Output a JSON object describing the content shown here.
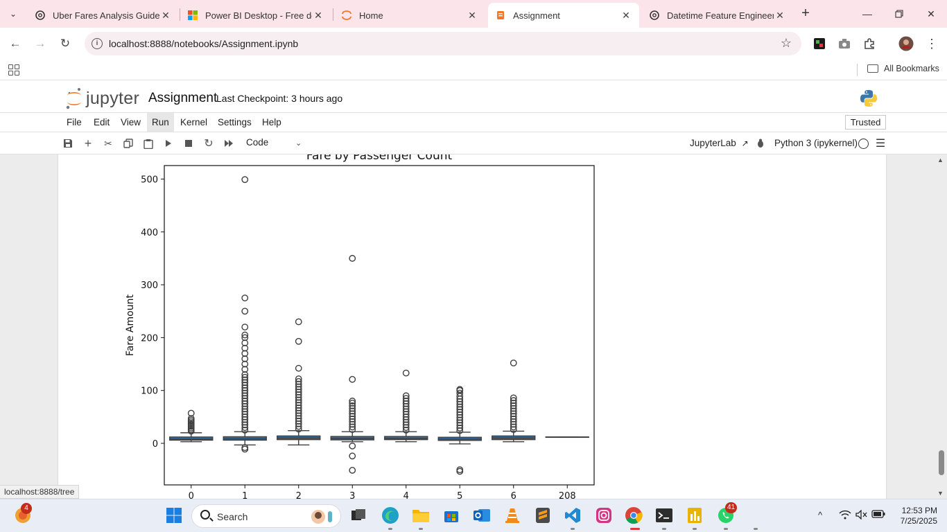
{
  "browser": {
    "tabs": [
      {
        "title": "Uber Fares Analysis Guide",
        "icon": "chatgpt-icon",
        "active": false
      },
      {
        "title": "Power BI Desktop - Free dow",
        "icon": "microsoft-icon",
        "active": false
      },
      {
        "title": "Home",
        "icon": "jupyter-icon",
        "active": false
      },
      {
        "title": "Assignment",
        "icon": "jupyter-notebook-icon",
        "active": true
      },
      {
        "title": "Datetime Feature Engineerin",
        "icon": "chatgpt-icon",
        "active": false
      }
    ],
    "url": "localhost:8888/notebooks/Assignment.ipynb",
    "bookmarks_label": "All Bookmarks",
    "status_url": "localhost:8888/tree"
  },
  "jupyter": {
    "logo_text": "jupyter",
    "notebook_title": "Assignment",
    "checkpoint": "Last Checkpoint: 3 hours ago",
    "menus": [
      "File",
      "Edit",
      "View",
      "Run",
      "Kernel",
      "Settings",
      "Help"
    ],
    "trusted": "Trusted",
    "cell_type": "Code",
    "jupyterlab_label": "JupyterLab",
    "kernel_name": "Python 3 (ipykernel)"
  },
  "chart_data": {
    "type": "box",
    "title": "Fare by Passenger Count",
    "ylabel": "Fare Amount",
    "xlabel": "",
    "ylim": [
      -60,
      520
    ],
    "yticks": [
      0,
      100,
      200,
      300,
      400,
      500
    ],
    "categories": [
      "0",
      "1",
      "2",
      "3",
      "4",
      "5",
      "6",
      "208"
    ],
    "box_color": "#3b6b96",
    "boxes": [
      {
        "q1": 6,
        "median": 8,
        "q3": 12,
        "whislo": 3,
        "whishi": 20,
        "fliers": [
          23,
          26,
          29,
          32,
          35,
          38,
          41,
          44,
          47,
          57
        ]
      },
      {
        "q1": 6,
        "median": 8.5,
        "q3": 12.5,
        "whislo": -3,
        "whishi": 22,
        "fliers": [
          25,
          30,
          35,
          40,
          45,
          50,
          55,
          60,
          65,
          70,
          75,
          80,
          85,
          90,
          95,
          100,
          105,
          110,
          115,
          120,
          125,
          130,
          140,
          150,
          160,
          170,
          180,
          190,
          200,
          205,
          220,
          250,
          275,
          499,
          -8,
          -11
        ]
      },
      {
        "q1": 7,
        "median": 10,
        "q3": 14,
        "whislo": -3,
        "whishi": 24,
        "fliers": [
          27,
          32,
          37,
          42,
          47,
          52,
          57,
          62,
          67,
          72,
          77,
          82,
          87,
          92,
          97,
          102,
          107,
          112,
          117,
          122,
          142,
          193,
          230
        ]
      },
      {
        "q1": 6.5,
        "median": 9,
        "q3": 13,
        "whislo": 3,
        "whishi": 22,
        "fliers": [
          26,
          31,
          36,
          41,
          46,
          51,
          56,
          61,
          66,
          71,
          76,
          80,
          121,
          350,
          -5,
          -24,
          -51
        ]
      },
      {
        "q1": 7,
        "median": 9,
        "q3": 13,
        "whislo": 3,
        "whishi": 22,
        "fliers": [
          25,
          30,
          35,
          40,
          45,
          50,
          55,
          60,
          65,
          70,
          75,
          80,
          85,
          90,
          133
        ]
      },
      {
        "q1": 5.5,
        "median": 8,
        "q3": 11.5,
        "whislo": -1,
        "whishi": 21,
        "fliers": [
          24,
          29,
          34,
          39,
          44,
          49,
          54,
          59,
          64,
          69,
          74,
          79,
          84,
          89,
          95,
          100,
          102,
          -50,
          -53
        ]
      },
      {
        "q1": 7,
        "median": 10,
        "q3": 14,
        "whislo": 3,
        "whishi": 23,
        "fliers": [
          26,
          31,
          36,
          41,
          46,
          51,
          56,
          61,
          66,
          71,
          76,
          81,
          86,
          152
        ]
      },
      {
        "q1": 12,
        "median": 12,
        "q3": 12,
        "whislo": 12,
        "whishi": 12,
        "fliers": []
      }
    ]
  },
  "taskbar": {
    "search_label": "Search",
    "notif_badge": "4",
    "whatsapp_badge": "41",
    "time": "12:53 PM",
    "date": "7/25/2025"
  }
}
